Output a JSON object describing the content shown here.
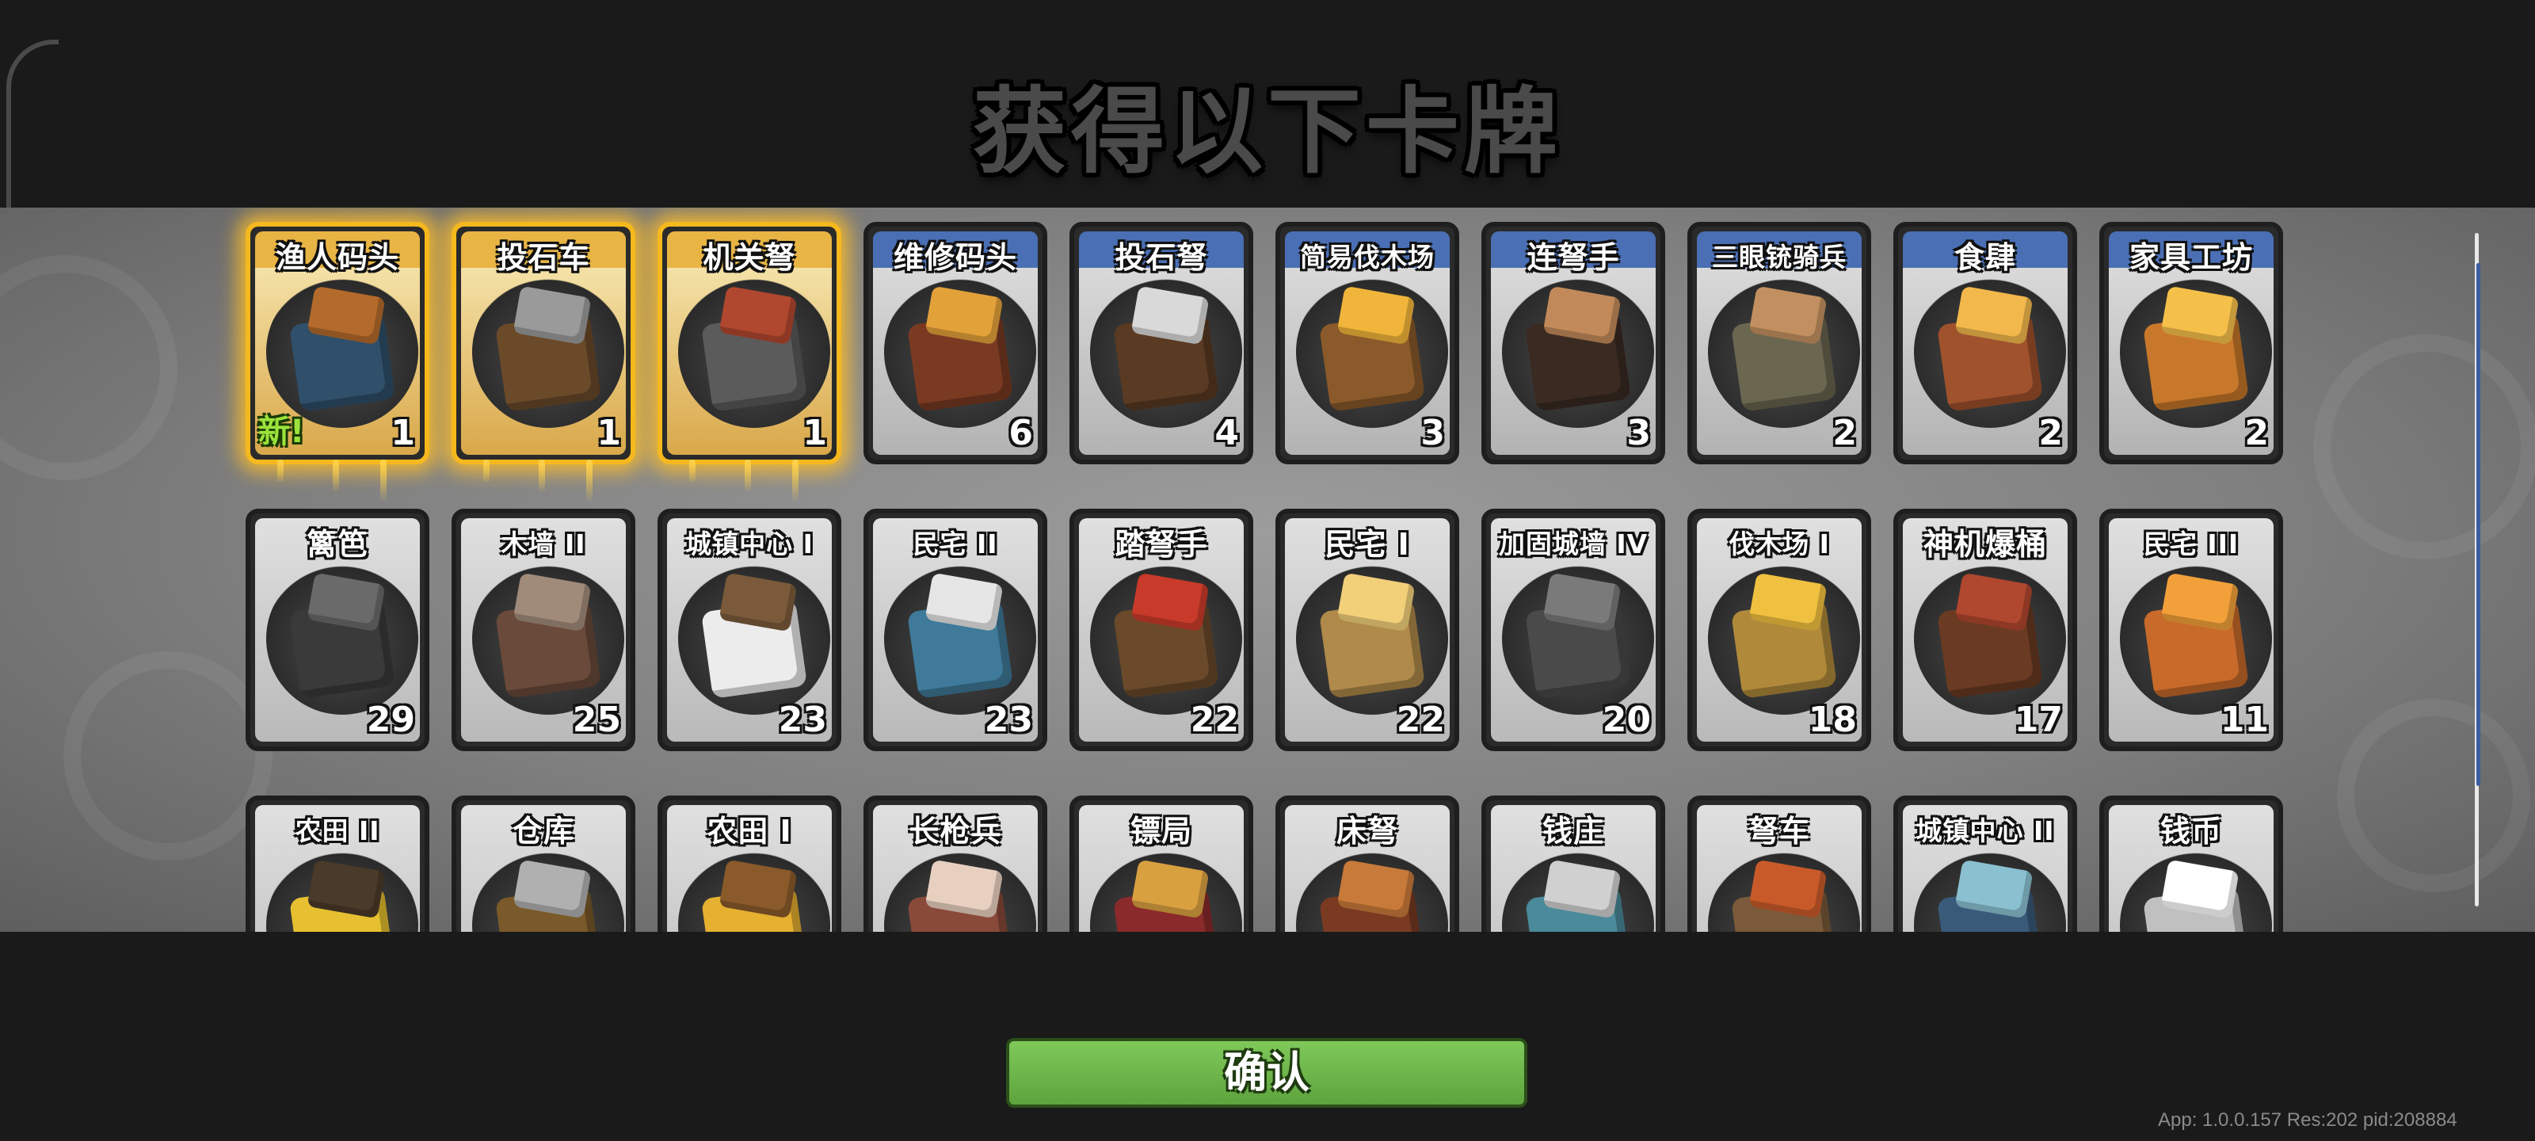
{
  "title": "获得以下卡牌",
  "confirm_label": "确认",
  "version_text": "App: 1.0.0.157 Res:202 pid:208884",
  "new_label": "新!",
  "cards": [
    {
      "name": "渔人码头",
      "count": "1",
      "frame": "gold",
      "is_new": true,
      "icon": "fisherman-dock-icon"
    },
    {
      "name": "投石车",
      "count": "1",
      "frame": "gold",
      "icon": "catapult-icon"
    },
    {
      "name": "机关弩",
      "count": "1",
      "frame": "gold",
      "icon": "mechanism-crossbow-icon"
    },
    {
      "name": "维修码头",
      "count": "6",
      "frame": "blue",
      "icon": "repair-dock-icon"
    },
    {
      "name": "投石弩",
      "count": "4",
      "frame": "blue",
      "icon": "stone-crossbow-icon"
    },
    {
      "name": "简易伐木场",
      "count": "3",
      "frame": "blue",
      "icon": "simple-lumber-mill-icon"
    },
    {
      "name": "连弩手",
      "count": "3",
      "frame": "blue",
      "icon": "repeating-crossbowman-icon"
    },
    {
      "name": "三眼铳骑兵",
      "count": "2",
      "frame": "blue",
      "icon": "three-eyed-gun-cavalry-icon"
    },
    {
      "name": "食肆",
      "count": "2",
      "frame": "blue",
      "icon": "eatery-icon"
    },
    {
      "name": "家具工坊",
      "count": "2",
      "frame": "blue",
      "icon": "furniture-workshop-icon"
    },
    {
      "name": "篱笆",
      "count": "29",
      "frame": "grey",
      "icon": "fence-icon"
    },
    {
      "name": "木墙 II",
      "count": "25",
      "frame": "grey",
      "icon": "wooden-wall-icon"
    },
    {
      "name": "城镇中心 I",
      "count": "23",
      "frame": "grey",
      "icon": "town-center-icon"
    },
    {
      "name": "民宅 II",
      "count": "23",
      "frame": "grey",
      "icon": "house-2-icon"
    },
    {
      "name": "踏弩手",
      "count": "22",
      "frame": "grey",
      "icon": "foot-crossbowman-icon"
    },
    {
      "name": "民宅 I",
      "count": "22",
      "frame": "grey",
      "icon": "house-1-icon"
    },
    {
      "name": "加固城墙 IV",
      "count": "20",
      "frame": "grey",
      "icon": "reinforced-wall-icon"
    },
    {
      "name": "伐木场 I",
      "count": "18",
      "frame": "grey",
      "icon": "lumber-mill-icon"
    },
    {
      "name": "神机爆桶",
      "count": "17",
      "frame": "grey",
      "icon": "explosive-barrel-icon"
    },
    {
      "name": "民宅 III",
      "count": "11",
      "frame": "grey",
      "icon": "house-3-icon"
    },
    {
      "name": "农田 II",
      "count": "",
      "frame": "grey",
      "icon": "farm-2-icon"
    },
    {
      "name": "仓库",
      "count": "",
      "frame": "grey",
      "icon": "warehouse-icon"
    },
    {
      "name": "农田 I",
      "count": "",
      "frame": "grey",
      "icon": "farm-1-icon"
    },
    {
      "name": "长枪兵",
      "count": "",
      "frame": "grey",
      "icon": "spearman-icon"
    },
    {
      "name": "镖局",
      "count": "",
      "frame": "grey",
      "icon": "escort-agency-icon"
    },
    {
      "name": "床弩",
      "count": "",
      "frame": "grey",
      "icon": "ballista-icon"
    },
    {
      "name": "钱庄",
      "count": "",
      "frame": "grey",
      "icon": "bank-icon"
    },
    {
      "name": "弩车",
      "count": "",
      "frame": "grey",
      "icon": "crossbow-cart-icon"
    },
    {
      "name": "城镇中心 II",
      "count": "",
      "frame": "grey",
      "icon": "town-center-2-icon"
    },
    {
      "name": "钱币",
      "count": "",
      "frame": "grey",
      "icon": "coin-icon"
    }
  ],
  "colors": {
    "gold_glow": "#f5b81e",
    "blue_header": "#4a6fb5",
    "confirm_green": "#6cb548",
    "new_green": "#9be33c"
  }
}
